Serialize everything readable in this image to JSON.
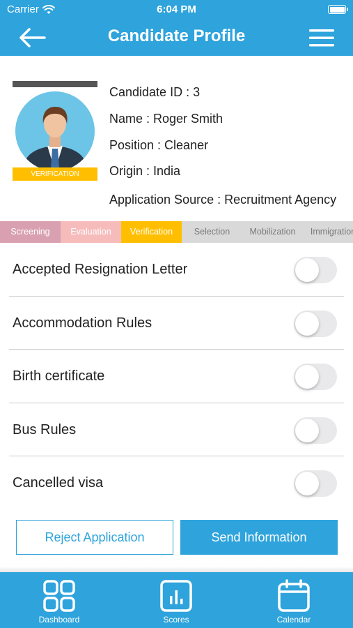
{
  "status_bar": {
    "carrier": "Carrier",
    "time": "6:04 PM"
  },
  "header": {
    "title": "Candidate Profile"
  },
  "profile": {
    "badge": "VERIFICATION",
    "candidate_id": "Candidate ID : 3",
    "name": "Name : Roger Smith",
    "position": "Position : Cleaner",
    "origin": "Origin : India",
    "application_source": "Application Source : Recruitment Agency"
  },
  "stages": [
    {
      "label": "Screening",
      "color": "#d9a0b2"
    },
    {
      "label": "Evaluation",
      "color": "#f6bcbc"
    },
    {
      "label": "Verification",
      "color": "#ffbf00"
    },
    {
      "label": "Selection",
      "color": "#d9d9d9",
      "text_color": "#7a7a7a"
    },
    {
      "label": "Mobilization",
      "color": "#d9d9d9",
      "text_color": "#7a7a7a"
    },
    {
      "label": "Immigration",
      "color": "#d9d9d9",
      "text_color": "#7a7a7a"
    }
  ],
  "documents": [
    {
      "label": "Accepted Resignation Letter",
      "checked": false
    },
    {
      "label": "Accommodation Rules",
      "checked": false
    },
    {
      "label": "Birth certificate",
      "checked": false
    },
    {
      "label": "Bus Rules",
      "checked": false
    },
    {
      "label": "Cancelled visa",
      "checked": false
    }
  ],
  "actions": {
    "reject_label": "Reject Application",
    "send_label": "Send Information"
  },
  "tabs": [
    {
      "label": "Dashboard",
      "icon": "dashboard-grid-icon"
    },
    {
      "label": "Scores",
      "icon": "bar-chart-icon"
    },
    {
      "label": "Calendar",
      "icon": "calendar-icon"
    }
  ],
  "colors": {
    "primary": "#2ea3dc",
    "badge": "#ffbf00"
  }
}
